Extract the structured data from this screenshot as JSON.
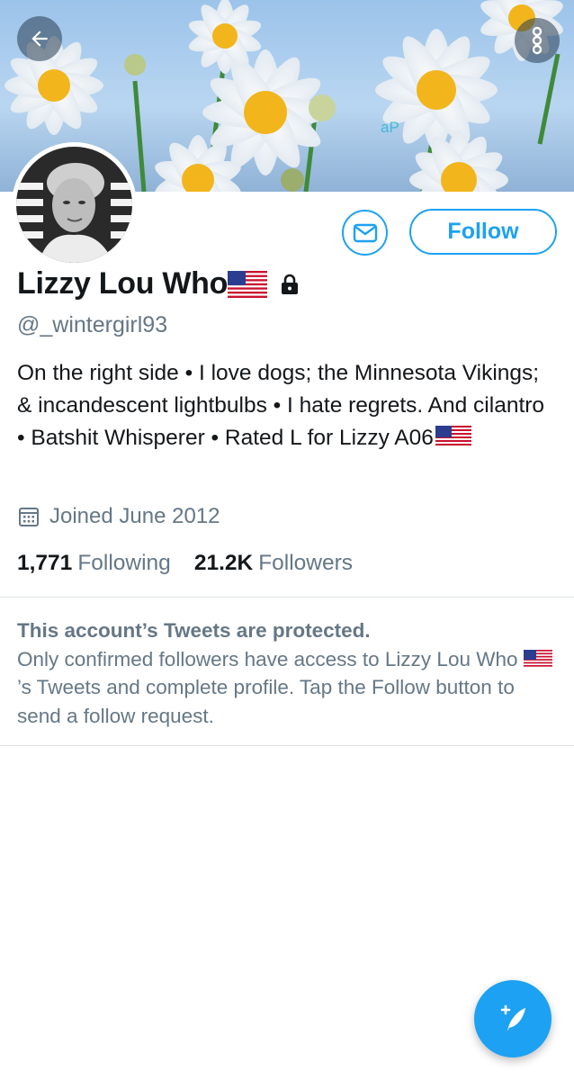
{
  "header": {
    "back_icon": "arrow-left-icon",
    "more_icon": "more-vertical-icon",
    "banner_watermark": "aP"
  },
  "profile": {
    "display_name": "Lizzy Lou Who",
    "flag_icon": "us-flag-icon",
    "lock_icon": "lock-icon",
    "handle": "@_wintergirl93",
    "bio": "On the right side • I love dogs; the Minnesota Vikings; & incandescent lightbulbs • I hate regrets. And cilantro • Batshit Whisperer • Rated L for Lizzy A06",
    "joined": "Joined June 2012",
    "following_count": "1,771",
    "following_label": "Following",
    "followers_count": "21.2K",
    "followers_label": "Followers"
  },
  "actions": {
    "message_icon": "envelope-icon",
    "follow_label": "Follow"
  },
  "protected": {
    "title": "This account’s Tweets are protected.",
    "body_part1": "Only confirmed followers have access to Lizzy Lou Who ",
    "body_part2": "’s Tweets and complete profile. Tap the Follow button to send a follow request."
  },
  "fab": {
    "icon": "compose-tweet-icon"
  },
  "colors": {
    "accent": "#1da1f2",
    "secondary_text": "#657786",
    "primary_text": "#14171a"
  }
}
